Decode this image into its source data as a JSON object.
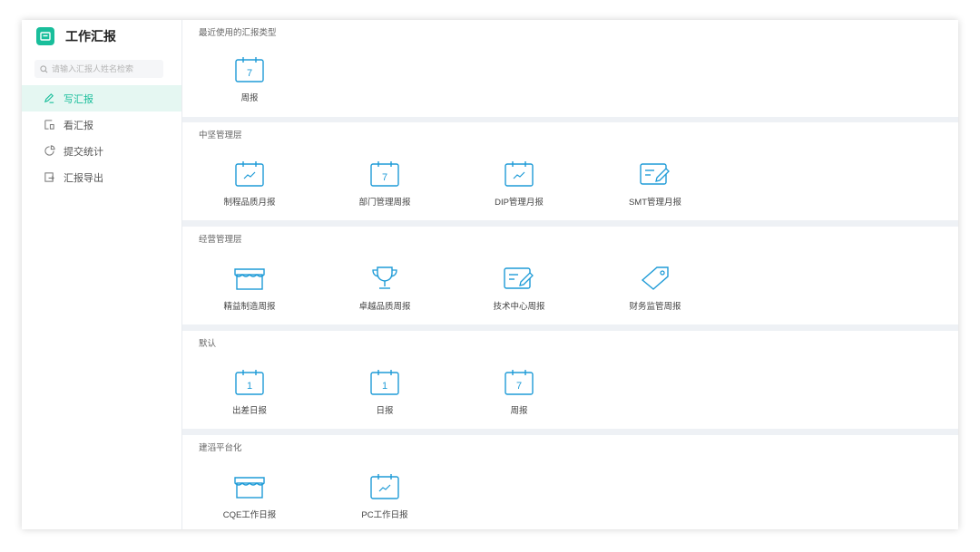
{
  "app": {
    "title": "工作汇报",
    "accent": "#19be9b"
  },
  "search": {
    "placeholder": "请输入汇报人姓名检索"
  },
  "nav": [
    {
      "label": "写汇报",
      "icon": "edit-icon",
      "active": true
    },
    {
      "label": "看汇报",
      "icon": "document-icon",
      "active": false
    },
    {
      "label": "提交统计",
      "icon": "pie-chart-icon",
      "active": false
    },
    {
      "label": "汇报导出",
      "icon": "export-icon",
      "active": false
    }
  ],
  "sections": [
    {
      "title": "最近使用的汇报类型",
      "items": [
        {
          "label": "周报",
          "icon": "calendar-7-icon"
        }
      ]
    },
    {
      "title": "中坚管理层",
      "items": [
        {
          "label": "制程品质月报",
          "icon": "calendar-trend-icon"
        },
        {
          "label": "部门管理周报",
          "icon": "calendar-7-icon"
        },
        {
          "label": "DIP管理月报",
          "icon": "calendar-trend-icon"
        },
        {
          "label": "SMT管理月报",
          "icon": "edit-document-icon"
        }
      ]
    },
    {
      "title": "经营管理层",
      "items": [
        {
          "label": "精益制造周报",
          "icon": "store-icon"
        },
        {
          "label": "卓越品质周报",
          "icon": "trophy-icon"
        },
        {
          "label": "技术中心周报",
          "icon": "edit-document-icon"
        },
        {
          "label": "财务监管周报",
          "icon": "tag-icon"
        }
      ]
    },
    {
      "title": "默认",
      "items": [
        {
          "label": "出差日报",
          "icon": "calendar-1-icon"
        },
        {
          "label": "日报",
          "icon": "calendar-1-icon"
        },
        {
          "label": "周报",
          "icon": "calendar-7-icon"
        }
      ]
    },
    {
      "title": "建滔平台化",
      "items": [
        {
          "label": "CQE工作日报",
          "icon": "store-icon"
        },
        {
          "label": "PC工作日报",
          "icon": "calendar-trend-icon"
        }
      ]
    }
  ]
}
